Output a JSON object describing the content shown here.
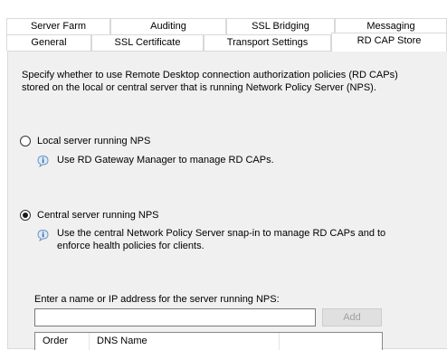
{
  "tabs": {
    "back": [
      "Server Farm",
      "Auditing",
      "SSL Bridging",
      "Messaging"
    ],
    "front": [
      "General",
      "SSL Certificate",
      "Transport Settings",
      "RD CAP Store"
    ],
    "active": "RD CAP Store"
  },
  "description": "Specify whether to use Remote Desktop connection authorization policies (RD CAPs) stored on the local or central server that is running Network Policy Server (NPS).",
  "options": [
    {
      "label": "Local server running NPS",
      "checked": false,
      "info": "Use RD Gateway Manager to manage RD CAPs."
    },
    {
      "label": "Central server running NPS",
      "checked": true,
      "info": "Use the central Network Policy Server snap-in to manage RD CAPs and to enforce health policies for clients."
    }
  ],
  "server_field": {
    "label": "Enter a name or IP address for the server running NPS:",
    "value": "",
    "add_label": "Add"
  },
  "table": {
    "headers": [
      "Order",
      "DNS Name",
      ""
    ]
  },
  "icons": {
    "info": "info-icon"
  }
}
